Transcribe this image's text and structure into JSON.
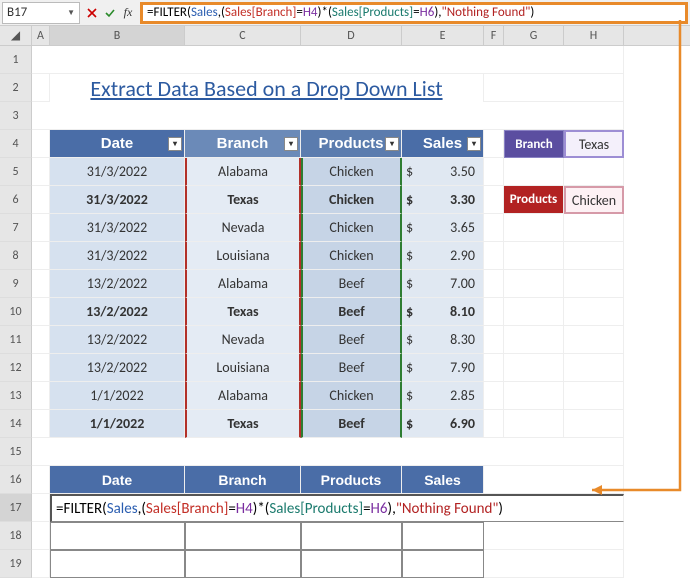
{
  "name_box": "B17",
  "formula_bar_plain": "=FILTER(Sales,(Sales[Branch] = H4)*(Sales[Products]=H6),\"Nothing Found\")",
  "formula_tokens": [
    {
      "t": "=",
      "c": "fn"
    },
    {
      "t": "FILTER",
      "c": "fn"
    },
    {
      "t": "(",
      "c": "fn"
    },
    {
      "t": "Sales",
      "c": "blue"
    },
    {
      "t": ",",
      "c": "fn"
    },
    {
      "t": "(",
      "c": "fn"
    },
    {
      "t": "Sales[Branch]",
      "c": "red"
    },
    {
      "t": " = ",
      "c": "fn"
    },
    {
      "t": "H4",
      "c": "purple"
    },
    {
      "t": ")",
      "c": "fn"
    },
    {
      "t": "*",
      "c": "fn"
    },
    {
      "t": "(",
      "c": "fn"
    },
    {
      "t": "Sales[Products]",
      "c": "teal"
    },
    {
      "t": "=",
      "c": "fn"
    },
    {
      "t": "H6",
      "c": "purple"
    },
    {
      "t": ")",
      "c": "fn"
    },
    {
      "t": ",",
      "c": "fn"
    },
    {
      "t": "\"Nothing Found\"",
      "c": "str"
    },
    {
      "t": ")",
      "c": "fn"
    }
  ],
  "columns": [
    "",
    "A",
    "B",
    "C",
    "D",
    "E",
    "F",
    "G",
    "H"
  ],
  "title": "Extract Data Based on a Drop Down List",
  "headers": {
    "date": "Date",
    "branch": "Branch",
    "products": "Products",
    "sales": "Sales"
  },
  "rows": [
    {
      "date": "31/3/2022",
      "branch": "Alabama",
      "product": "Chicken",
      "sales": "3.50"
    },
    {
      "date": "31/3/2022",
      "branch": "Texas",
      "product": "Chicken",
      "sales": "3.30",
      "bold": true
    },
    {
      "date": "31/3/2022",
      "branch": "Nevada",
      "product": "Chicken",
      "sales": "3.65"
    },
    {
      "date": "31/3/2022",
      "branch": "Louisiana",
      "product": "Chicken",
      "sales": "2.90"
    },
    {
      "date": "13/2/2022",
      "branch": "Alabama",
      "product": "Beef",
      "sales": "7.00"
    },
    {
      "date": "13/2/2022",
      "branch": "Texas",
      "product": "Beef",
      "sales": "8.10",
      "bold": true
    },
    {
      "date": "13/2/2022",
      "branch": "Nevada",
      "product": "Beef",
      "sales": "8.30"
    },
    {
      "date": "13/2/2022",
      "branch": "Louisiana",
      "product": "Beef",
      "sales": "7.90"
    },
    {
      "date": "1/1/2022",
      "branch": "Alabama",
      "product": "Chicken",
      "sales": "2.85"
    },
    {
      "date": "1/1/2022",
      "branch": "Texas",
      "product": "Beef",
      "sales": "6.90",
      "bold": true
    }
  ],
  "side": {
    "branch_label": "Branch",
    "branch_value": "Texas",
    "products_label": "Products",
    "products_value": "Chicken"
  },
  "row_labels": [
    "1",
    "2",
    "3",
    "4",
    "5",
    "6",
    "7",
    "8",
    "9",
    "10",
    "11",
    "12",
    "13",
    "14",
    "15",
    "16",
    "17",
    "18",
    "19"
  ],
  "dollar": "$"
}
